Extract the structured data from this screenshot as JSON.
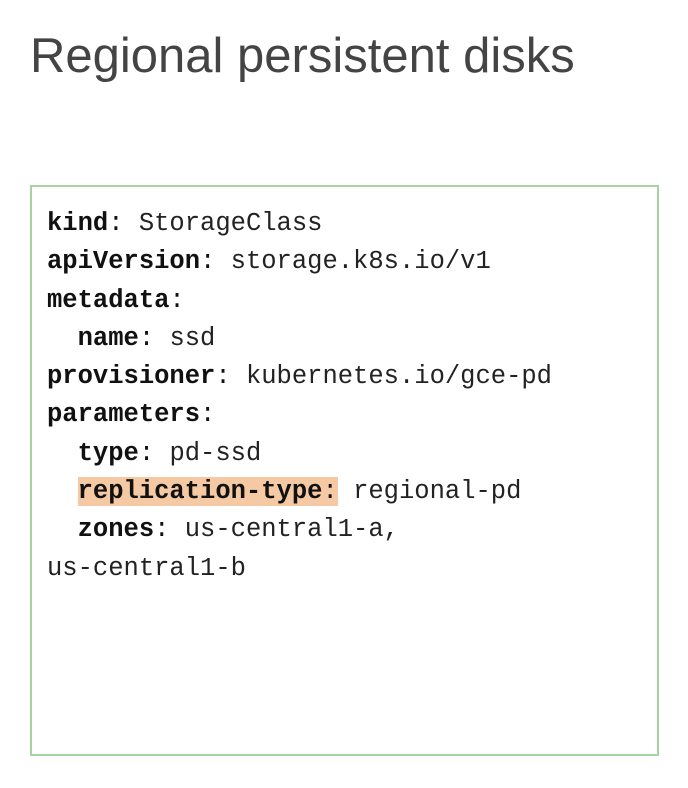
{
  "title": "Regional persistent disks",
  "highlight_color": "#f4c9a3",
  "border_color": "#a6d3a1",
  "code_lines": [
    {
      "indent": "",
      "key": "kind",
      "value": "StorageClass"
    },
    {
      "indent": "",
      "key": "apiVersion",
      "value": "storage.k8s.io/v1"
    },
    {
      "indent": "",
      "key": "metadata",
      "value": ""
    },
    {
      "indent": "  ",
      "key": "name",
      "value": "ssd"
    },
    {
      "indent": "",
      "key": "provisioner",
      "value": "kubernetes.io/gce-pd"
    },
    {
      "indent": "",
      "key": "parameters",
      "value": ""
    },
    {
      "indent": "  ",
      "key": "type",
      "value": "pd-ssd"
    },
    {
      "indent": "  ",
      "key": "replication-type",
      "value": "regional-pd",
      "highlight": true
    },
    {
      "indent": "  ",
      "key": "zones",
      "value": "us-central1-a,"
    },
    {
      "indent": "",
      "key": "",
      "value": "us-central1-b"
    }
  ]
}
